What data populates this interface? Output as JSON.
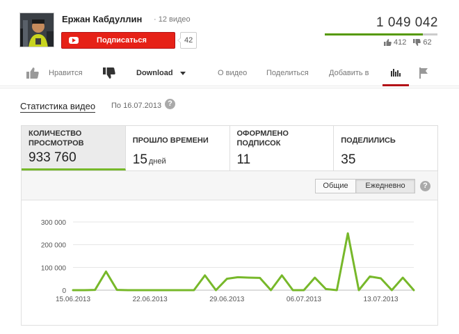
{
  "header": {
    "channel_name": "Ержан Кабдуллин",
    "video_count": "· 12 видео",
    "subscribe_label": "Подписаться",
    "subscriber_count": "42",
    "view_count": "1 049 042",
    "like_ratio": 0.87,
    "likes": "412",
    "dislikes": "62"
  },
  "actions": {
    "like_label": "Нравится",
    "download_label": "Download",
    "about_label": "О видео",
    "share_label": "Поделиться",
    "add_label": "Добавить в"
  },
  "stats": {
    "title": "Статистика видео",
    "date": "По 16.07.2013",
    "help": "?",
    "tiles": [
      {
        "label": "Количество просмотров",
        "value": "933 760",
        "unit": ""
      },
      {
        "label": "Прошло времени",
        "value": "15",
        "unit": "дней"
      },
      {
        "label": "Оформлено подписок",
        "value": "11",
        "unit": ""
      },
      {
        "label": "Поделились",
        "value": "35",
        "unit": ""
      }
    ],
    "toggle_total": "Общие",
    "toggle_daily": "Ежедневно"
  },
  "chart_data": {
    "type": "line",
    "color": "#77b82a",
    "ylim": [
      0,
      300000
    ],
    "y_ticks": [
      0,
      100000,
      200000,
      300000
    ],
    "y_tick_labels": [
      "0",
      "100 000",
      "200 000",
      "300 000"
    ],
    "x_tick_labels": [
      "15.06.2013",
      "22.06.2013",
      "29.06.2013",
      "06.07.2013",
      "13.07.2013"
    ],
    "x_tick_days": [
      0,
      7,
      14,
      21,
      28
    ],
    "x": [
      0,
      1,
      2,
      3,
      4,
      5,
      6,
      7,
      8,
      9,
      10,
      11,
      12,
      13,
      14,
      15,
      16,
      17,
      18,
      19,
      20,
      21,
      22,
      23,
      24,
      25,
      26,
      27,
      28,
      29,
      30
    ],
    "values": [
      0,
      0,
      1000,
      82000,
      1000,
      0,
      0,
      0,
      0,
      0,
      0,
      0,
      65000,
      0,
      50000,
      57000,
      55000,
      54000,
      0,
      65000,
      0,
      0,
      55000,
      5000,
      0,
      250000,
      0,
      60000,
      52000,
      0,
      55000,
      0
    ]
  }
}
